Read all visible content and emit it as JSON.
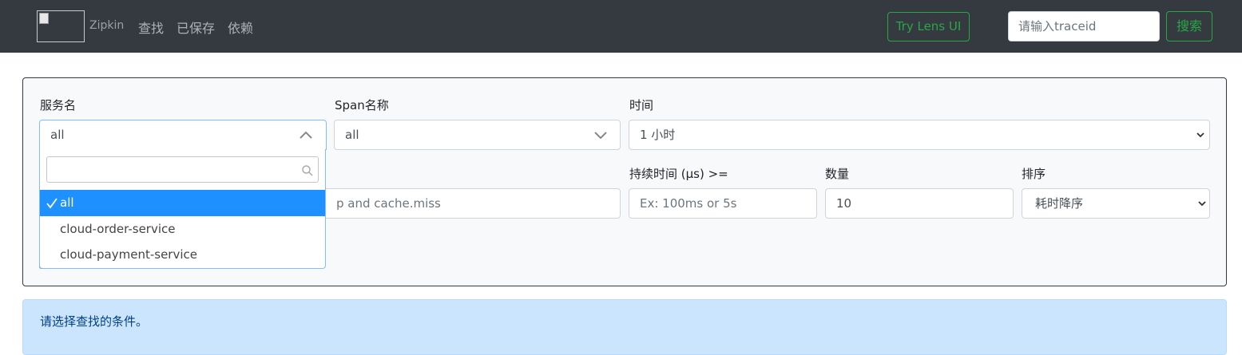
{
  "nav": {
    "brand": "Zipkin",
    "links": [
      "查找",
      "已保存",
      "依赖"
    ],
    "lens_button": "Try Lens UI",
    "traceid_placeholder": "请输入traceid",
    "search_button": "搜索"
  },
  "form": {
    "service_label": "服务名",
    "service_value": "all",
    "span_label": "Span名称",
    "span_value": "all",
    "time_label": "时间",
    "time_value": "1 小时",
    "annotation_placeholder_visible": "p and cache.miss",
    "duration_label": "持续时间 (μs) >=",
    "duration_placeholder": "Ex: 100ms or 5s",
    "limit_label": "数量",
    "limit_value": "10",
    "sort_label": "排序",
    "sort_value": "耗时降序"
  },
  "dropdown": {
    "search_value": "",
    "options": [
      "all",
      "cloud-order-service",
      "cloud-payment-service"
    ],
    "selected_index": 0
  },
  "alert": {
    "message": "请选择查找的条件。"
  }
}
